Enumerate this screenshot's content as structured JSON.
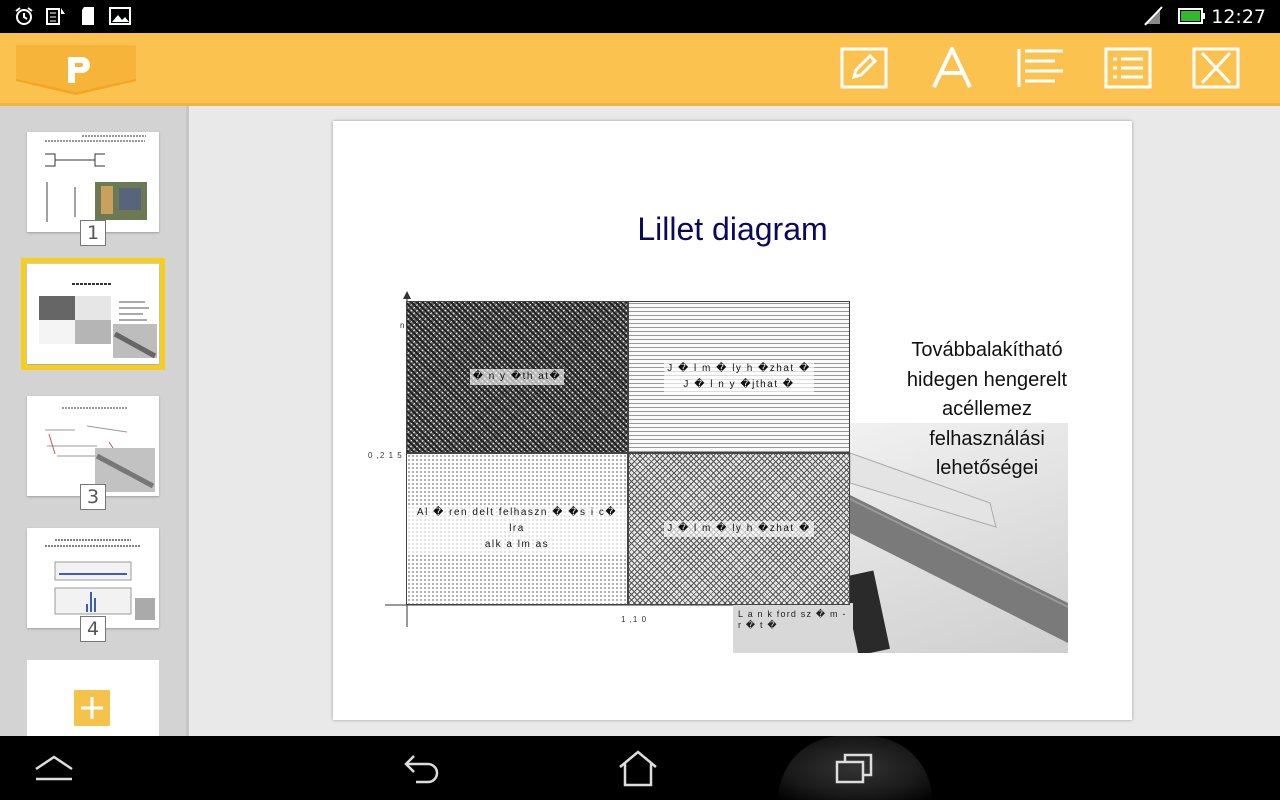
{
  "status_bar": {
    "clock": "12:27",
    "left_icons": [
      "alarm-icon",
      "sim-icon",
      "sd-card-icon",
      "gallery-icon"
    ],
    "right_icons": [
      "muted-signal-icon",
      "battery-icon"
    ]
  },
  "toolbar": {
    "logo_letter": "P",
    "buttons": [
      "edit-icon",
      "text-format-icon",
      "align-left-icon",
      "bullet-list-icon",
      "close-icon"
    ]
  },
  "slides": [
    {
      "number": "1",
      "title": "Tension test specimen",
      "selected": false
    },
    {
      "number": "2",
      "title": "Lillet diagram",
      "selected": true
    },
    {
      "number": "3",
      "title": "Forming limit diagram",
      "selected": false
    },
    {
      "number": "4",
      "title": "Measurement results",
      "selected": false
    }
  ],
  "add_slide": {
    "icon": "plus-icon"
  },
  "slide": {
    "title": "Lillet diagram",
    "quadrants": {
      "q1": "� n y �th at�",
      "q2_line1": "J � l m � ly h �zhat �",
      "q2_line2": "J � l n y �jthat �",
      "q3_line1": "Al � ren delt felhaszn � �s i c� lra",
      "q3_line2": "alk a lm as",
      "q4": "J � l m � ly h �zhat �"
    },
    "axis": {
      "y_label": "n",
      "y_tick": "0 ,2 1 5",
      "x_tick": "1 ,1 0"
    },
    "photo_caption": "L a n k ford sz � m - r � t �",
    "side_text": [
      "Továbbalakítható",
      "hidegen hengerelt",
      "acéllemez",
      "felhasználási",
      "lehetőségei"
    ]
  },
  "navbar": {
    "buttons": [
      "recent-apps-up-icon",
      "back-icon",
      "home-icon",
      "recent-apps-icon"
    ]
  },
  "colors": {
    "toolbar": "#fbc24f",
    "accent": "#f6cf1a",
    "title": "#0a0a5c"
  }
}
